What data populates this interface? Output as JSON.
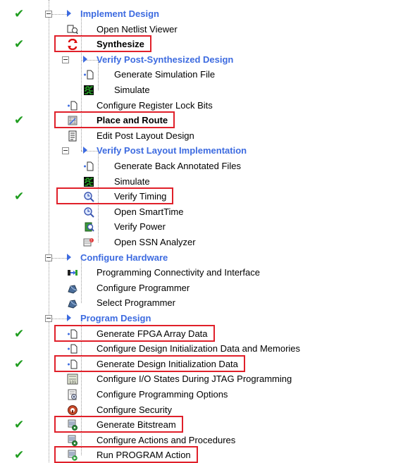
{
  "tree": [
    {
      "label": "Implement Design",
      "level": 0,
      "kind": "group",
      "done": true,
      "icon": "expand-arrow-icon",
      "box": false
    },
    {
      "label": "Open Netlist Viewer",
      "level": 1,
      "kind": "item",
      "done": false,
      "icon": "netlist-viewer-icon",
      "box": false
    },
    {
      "label": "Synthesize",
      "level": 1,
      "kind": "strong",
      "done": true,
      "icon": "synthesize-icon",
      "box": true
    },
    {
      "label": "Verify Post-Synthesized Design",
      "level": 1,
      "kind": "group",
      "done": false,
      "icon": "expand-arrow-icon",
      "box": false
    },
    {
      "label": "Generate Simulation File",
      "level": 2,
      "kind": "item",
      "done": false,
      "icon": "file-icon",
      "box": false
    },
    {
      "label": "Simulate",
      "level": 2,
      "kind": "item",
      "done": false,
      "icon": "waveform-icon",
      "box": false
    },
    {
      "label": "Configure Register Lock Bits",
      "level": 1,
      "kind": "item",
      "done": false,
      "icon": "file-icon",
      "box": false
    },
    {
      "label": "Place and Route",
      "level": 1,
      "kind": "strong",
      "done": true,
      "icon": "place-route-icon",
      "box": true
    },
    {
      "label": "Edit Post Layout Design",
      "level": 1,
      "kind": "item",
      "done": false,
      "icon": "document-icon",
      "box": false
    },
    {
      "label": "Verify Post Layout Implementation",
      "level": 1,
      "kind": "group",
      "done": false,
      "icon": "expand-arrow-icon",
      "box": false
    },
    {
      "label": "Generate Back Annotated Files",
      "level": 2,
      "kind": "item",
      "done": false,
      "icon": "file-icon",
      "box": false
    },
    {
      "label": "Simulate",
      "level": 2,
      "kind": "item",
      "done": false,
      "icon": "waveform-icon",
      "box": false
    },
    {
      "label": "Verify Timing",
      "level": 2,
      "kind": "item",
      "done": true,
      "icon": "timing-icon",
      "box": true
    },
    {
      "label": "Open SmartTime",
      "level": 2,
      "kind": "item",
      "done": false,
      "icon": "smarttime-icon",
      "box": false
    },
    {
      "label": "Verify Power",
      "level": 2,
      "kind": "item",
      "done": false,
      "icon": "power-icon",
      "box": false
    },
    {
      "label": "Open SSN Analyzer",
      "level": 2,
      "kind": "item",
      "done": false,
      "icon": "ssn-analyzer-icon",
      "box": false
    },
    {
      "label": "Configure Hardware",
      "level": 0,
      "kind": "group",
      "done": false,
      "icon": "expand-arrow-icon",
      "box": false
    },
    {
      "label": "Programming Connectivity and Interface",
      "level": 1,
      "kind": "item",
      "done": false,
      "icon": "connectivity-icon",
      "box": false
    },
    {
      "label": "Configure Programmer",
      "level": 1,
      "kind": "item",
      "done": false,
      "icon": "programmer-icon",
      "box": false
    },
    {
      "label": "Select Programmer",
      "level": 1,
      "kind": "item",
      "done": false,
      "icon": "programmer-icon",
      "box": false
    },
    {
      "label": "Program Design",
      "level": 0,
      "kind": "group",
      "done": false,
      "icon": "expand-arrow-icon",
      "box": false
    },
    {
      "label": "Generate FPGA Array Data",
      "level": 1,
      "kind": "item",
      "done": true,
      "icon": "file-icon",
      "box": true
    },
    {
      "label": "Configure Design Initialization Data and Memories",
      "level": 1,
      "kind": "item",
      "done": false,
      "icon": "file-icon",
      "box": false
    },
    {
      "label": "Generate Design Initialization Data",
      "level": 1,
      "kind": "item",
      "done": true,
      "icon": "file-icon",
      "box": true
    },
    {
      "label": "Configure I/O States During JTAG Programming",
      "level": 1,
      "kind": "item",
      "done": false,
      "icon": "io-states-icon",
      "box": false
    },
    {
      "label": "Configure Programming Options",
      "level": 1,
      "kind": "item",
      "done": false,
      "icon": "options-icon",
      "box": false
    },
    {
      "label": "Configure Security",
      "level": 1,
      "kind": "item",
      "done": false,
      "icon": "security-icon",
      "box": false
    },
    {
      "label": "Generate Bitstream",
      "level": 1,
      "kind": "item",
      "done": true,
      "icon": "bitstream-icon",
      "box": true
    },
    {
      "label": "Configure Actions and Procedures",
      "level": 1,
      "kind": "item",
      "done": false,
      "icon": "actions-icon",
      "box": false
    },
    {
      "label": "Run PROGRAM Action",
      "level": 1,
      "kind": "item",
      "done": true,
      "icon": "run-action-icon",
      "box": true
    }
  ],
  "colors": {
    "check": "#1f9d1f",
    "group": "#3d6be0",
    "highlight": "#e0202a"
  }
}
